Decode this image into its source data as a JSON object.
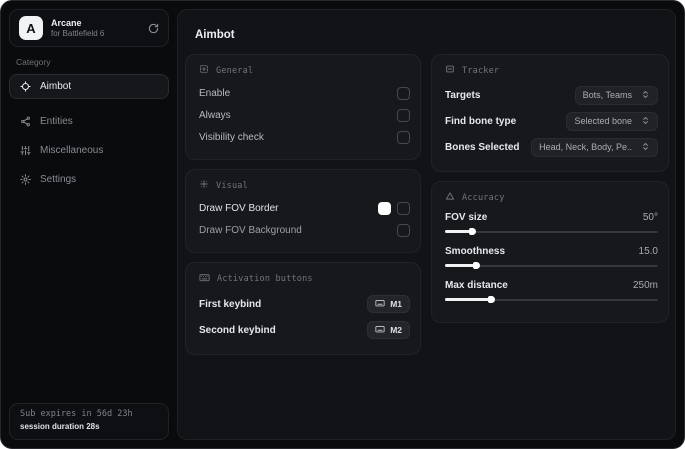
{
  "brand": {
    "logo_letter": "A",
    "title": "Arcane",
    "subtitle": "for Battlefield 6"
  },
  "sidebar": {
    "category_label": "Category",
    "items": [
      {
        "label": "Aimbot",
        "icon": "crosshair-icon",
        "active": true
      },
      {
        "label": "Entities",
        "icon": "entities-icon",
        "active": false
      },
      {
        "label": "Miscellaneous",
        "icon": "sliders-icon",
        "active": false
      },
      {
        "label": "Settings",
        "icon": "gear-icon",
        "active": false
      }
    ],
    "subscription": {
      "expiry": "Sub expires in 56d 23h",
      "session": "session duration 28s"
    }
  },
  "main": {
    "title": "Aimbot",
    "general": {
      "title": "General",
      "icon": "grid-square-icon",
      "rows": [
        {
          "label": "Enable",
          "checked": false
        },
        {
          "label": "Always",
          "checked": false
        },
        {
          "label": "Visibility check",
          "checked": false
        }
      ]
    },
    "visual": {
      "title": "Visual",
      "icon": "plus-icon",
      "rows": [
        {
          "label": "Draw FOV Border",
          "swatch": "#ffffff",
          "checked": false
        },
        {
          "label": "Draw FOV Background",
          "checked": false
        }
      ]
    },
    "activation": {
      "title": "Activation buttons",
      "icon": "keyboard-icon",
      "rows": [
        {
          "label": "First keybind",
          "key": "M1"
        },
        {
          "label": "Second keybind",
          "key": "M2"
        }
      ]
    },
    "tracker": {
      "title": "Tracker",
      "icon": "box-minus-icon",
      "rows": [
        {
          "label": "Targets",
          "value": "Bots, Teams"
        },
        {
          "label": "Find bone type",
          "value": "Selected bone"
        },
        {
          "label": "Bones Selected",
          "value": "Head, Neck, Body, Pe.."
        }
      ]
    },
    "accuracy": {
      "title": "Accuracy",
      "icon": "triangle-icon",
      "rows": [
        {
          "label": "FOV size",
          "value": "50°",
          "fill_pct": 13
        },
        {
          "label": "Smoothness",
          "value": "15.0",
          "fill_pct": 15
        },
        {
          "label": "Max distance",
          "value": "250m",
          "fill_pct": 22
        }
      ]
    }
  },
  "colors": {
    "fov_border_swatch": "#ffffff",
    "slider_fill": "#f2f3f4",
    "panel_bg": "#121317",
    "card_bg": "#17181c"
  }
}
